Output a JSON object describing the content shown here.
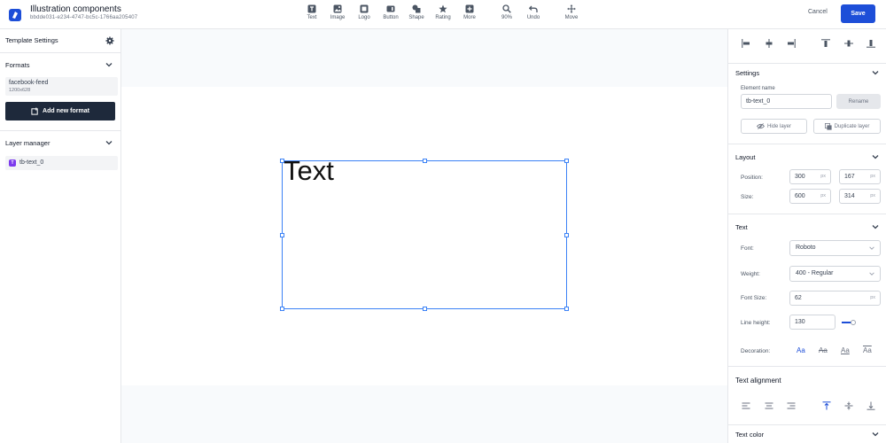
{
  "app": {
    "title": "Illustration components",
    "subtitle": "bbdde031-e234-4747-bc5c-1766aa205407"
  },
  "toolbar": {
    "tools": [
      {
        "label": "Text",
        "icon": "text-icon"
      },
      {
        "label": "Image",
        "icon": "image-icon"
      },
      {
        "label": "Logo",
        "icon": "logo-icon"
      },
      {
        "label": "Button",
        "icon": "button-icon"
      },
      {
        "label": "Shape",
        "icon": "shape-icon"
      },
      {
        "label": "Rating",
        "icon": "star-icon"
      },
      {
        "label": "More",
        "icon": "plus-icon"
      },
      {
        "label": "90%",
        "icon": "zoom-icon"
      },
      {
        "label": "Undo",
        "icon": "undo-icon"
      },
      {
        "label": "Move",
        "icon": "move-icon"
      }
    ],
    "cancel_label": "Cancel",
    "save_label": "Save",
    "accent": "#1d4ed8"
  },
  "left_panel": {
    "template_settings": "Template Settings",
    "formats_label": "Formats",
    "format_name": "facebook-feed",
    "format_size": "1200x628",
    "add_format": "Add new format",
    "layer_manager": "Layer manager",
    "layer_name": "tb-text_0",
    "layer_badge": "T"
  },
  "canvas": {
    "text_value": "Text"
  },
  "right_panel": {
    "settings_label": "Settings",
    "element_name_label": "Element name",
    "element_name_value": "tb-text_0",
    "rename_label": "Rename",
    "hide_layer": "Hide layer",
    "duplicate_layer": "Duplicate layer",
    "layout_label": "Layout",
    "position_label": "Position:",
    "position_x": "300",
    "position_y": "167",
    "size_label": "Size:",
    "size_w": "600",
    "size_h": "314",
    "unit": "px",
    "text_label": "Text",
    "font_label": "Font:",
    "font_value": "Roboto",
    "weight_label": "Weight:",
    "weight_value": "400 - Regular",
    "font_size_label": "Font Size:",
    "font_size_value": "62",
    "line_height_label": "Line height:",
    "line_height_value": "130",
    "decoration_label": "Decoration:",
    "decoration_sample": "Aa",
    "text_alignment_label": "Text alignment",
    "text_color_label": "Text color"
  }
}
